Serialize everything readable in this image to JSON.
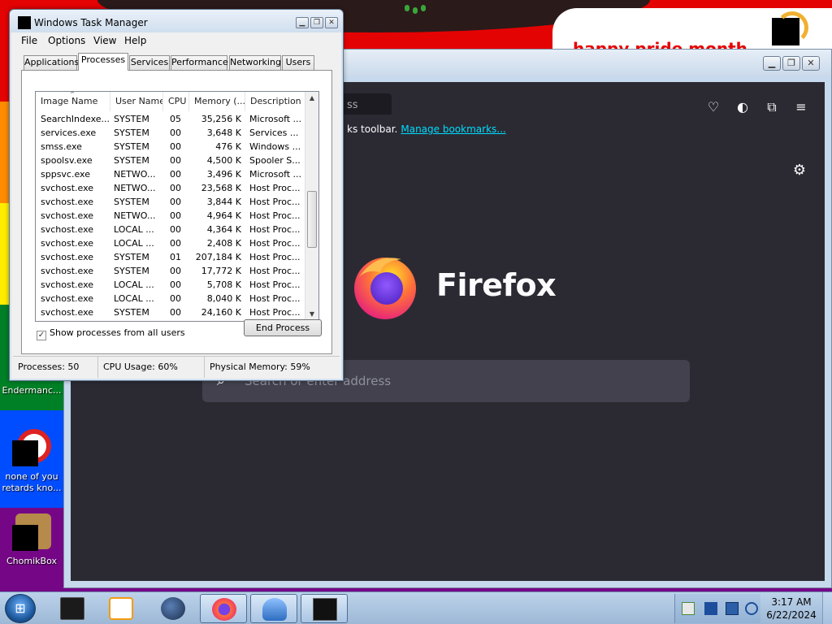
{
  "desktop": {
    "banner_text": "happy pride month",
    "icons": [
      {
        "label": "Endermanc..."
      },
      {
        "label": "none of you retards kno..."
      },
      {
        "label": "ChomikBox"
      }
    ]
  },
  "firefox": {
    "url_placeholder": "ss",
    "bookmarks_text": "ks toolbar.",
    "bookmarks_link": "Manage bookmarks...",
    "brand": "Firefox",
    "search_placeholder": "Search or enter address",
    "settings_icon": "gear-icon",
    "toolbar_icons": [
      "pocket-icon",
      "contrast-icon",
      "extensions-icon",
      "menu-icon"
    ]
  },
  "task_manager": {
    "title": "Windows Task Manager",
    "menu": [
      "File",
      "Options",
      "View",
      "Help"
    ],
    "tabs": [
      "Applications",
      "Processes",
      "Services",
      "Performance",
      "Networking",
      "Users"
    ],
    "active_tab": "Processes",
    "columns": [
      "Image Name",
      "User Name",
      "CPU",
      "Memory (...",
      "Description"
    ],
    "rows": [
      [
        "SearchIndexe...",
        "SYSTEM",
        "05",
        "35,256 K",
        "Microsoft ..."
      ],
      [
        "services.exe",
        "SYSTEM",
        "00",
        "3,648 K",
        "Services ..."
      ],
      [
        "smss.exe",
        "SYSTEM",
        "00",
        "476 K",
        "Windows ..."
      ],
      [
        "spoolsv.exe",
        "SYSTEM",
        "00",
        "4,500 K",
        "Spooler S..."
      ],
      [
        "sppsvc.exe",
        "NETWO...",
        "00",
        "3,496 K",
        "Microsoft ..."
      ],
      [
        "svchost.exe",
        "NETWO...",
        "00",
        "23,568 K",
        "Host Proc..."
      ],
      [
        "svchost.exe",
        "SYSTEM",
        "00",
        "3,844 K",
        "Host Proc..."
      ],
      [
        "svchost.exe",
        "NETWO...",
        "00",
        "4,964 K",
        "Host Proc..."
      ],
      [
        "svchost.exe",
        "LOCAL ...",
        "00",
        "4,364 K",
        "Host Proc..."
      ],
      [
        "svchost.exe",
        "LOCAL ...",
        "00",
        "2,408 K",
        "Host Proc..."
      ],
      [
        "svchost.exe",
        "SYSTEM",
        "01",
        "207,184 K",
        "Host Proc..."
      ],
      [
        "svchost.exe",
        "SYSTEM",
        "00",
        "17,772 K",
        "Host Proc..."
      ],
      [
        "svchost.exe",
        "LOCAL ...",
        "00",
        "5,708 K",
        "Host Proc..."
      ],
      [
        "svchost.exe",
        "LOCAL ...",
        "00",
        "8,040 K",
        "Host Proc..."
      ],
      [
        "svchost.exe",
        "SYSTEM",
        "00",
        "24,160 K",
        "Host Proc..."
      ]
    ],
    "show_all_label": "Show processes from all users",
    "show_all_checked": true,
    "end_process_label": "End Process",
    "status": {
      "processes": "Processes: 50",
      "cpu": "CPU Usage: 60%",
      "memory": "Physical Memory: 59%"
    }
  },
  "taskbar": {
    "start_icon": "windows-orb-icon",
    "apps": [
      "terminal-icon",
      "media-player-icon",
      "globe-icon",
      "firefox-icon",
      "app-icon",
      "taskmgr-icon"
    ],
    "active_apps": [
      "firefox-icon",
      "app-icon",
      "taskmgr-icon"
    ],
    "clock_time": "3:17 AM",
    "clock_date": "6/22/2024"
  },
  "colors": {
    "firefox_bg": "#2b2a33",
    "firefox_link": "#00ddff",
    "pride_red": "#e40303"
  }
}
